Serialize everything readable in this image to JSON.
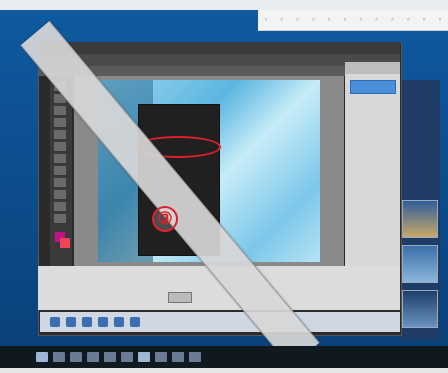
{
  "app": {
    "menu_tabs": [
      "",
      "",
      ""
    ],
    "context_menu": {
      "items": [
        "",
        "",
        "",
        "",
        "",
        "",
        "",
        "",
        "",
        "",
        "",
        "",
        ""
      ],
      "highlighted_index": 3
    }
  },
  "step_marker": "③",
  "colors": {
    "highlight": "#e0202a",
    "accent": "#4a90d9",
    "desktop": "#0d4a86"
  }
}
